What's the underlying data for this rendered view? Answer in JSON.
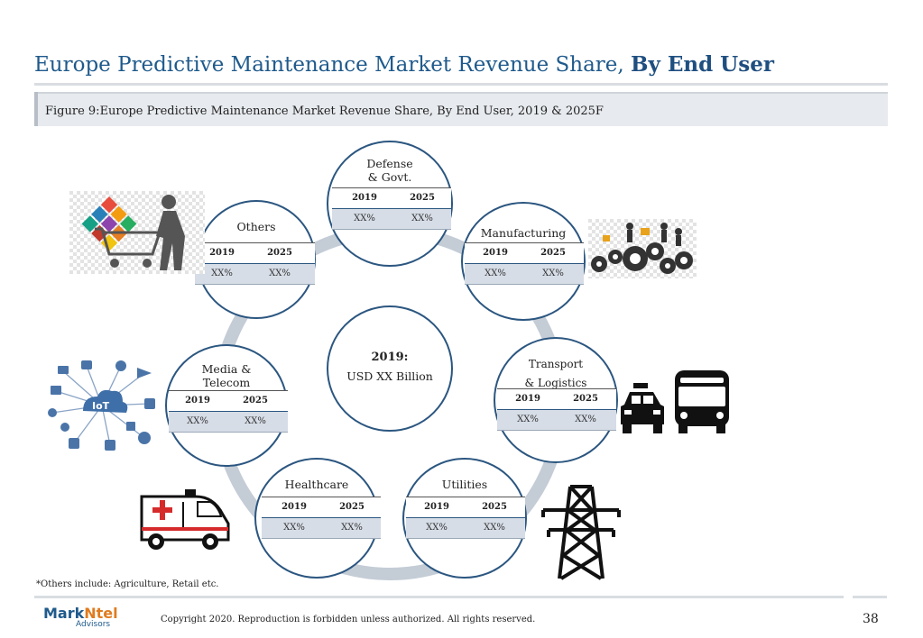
{
  "header": {
    "title_prefix": "Europe Predictive Maintenance Market Revenue Share, ",
    "title_bold": "By End User",
    "figure_label": "Figure 9:Europe Predictive Maintenance Market Revenue Share, By End User, 2019 & 2025F"
  },
  "center": {
    "year_label": "2019:",
    "value": "USD XX Billion"
  },
  "segments": {
    "defense": {
      "name": "Defense & Govt.",
      "col1": "2019",
      "col2": "2025",
      "val1": "XX%",
      "val2": "XX%"
    },
    "manufacturing": {
      "name": "Manufacturing",
      "col1": "2019",
      "col2": "2025",
      "val1": "XX%",
      "val2": "XX%"
    },
    "transport": {
      "name": "Transport & Logistics",
      "col1": "2019",
      "col2": "2025",
      "val1": "XX%",
      "val2": "XX%"
    },
    "utilities": {
      "name": "Utilities",
      "col1": "2019",
      "col2": "2025",
      "val1": "XX%",
      "val2": "XX%"
    },
    "healthcare": {
      "name": "Healthcare",
      "col1": "2019",
      "col2": "2025",
      "val1": "XX%",
      "val2": "XX%"
    },
    "media": {
      "name": "Media & Telecom",
      "col1": "2019",
      "col2": "2025",
      "val1": "XX%",
      "val2": "XX%"
    },
    "others": {
      "name": "Others",
      "col1": "2019",
      "col2": "2025",
      "val1": "XX%",
      "val2": "XX%"
    }
  },
  "icons": {
    "others": "shopping-cart-icon",
    "manufacturing": "gears-icon",
    "media": "iot-network-icon",
    "transport": "taxi-bus-icon",
    "healthcare": "ambulance-icon",
    "utilities": "power-tower-icon"
  },
  "iot_badge": "IoT",
  "footnote": "*Others include: Agriculture, Retail etc.",
  "footer": {
    "logo_main": "Mark",
    "logo_accent": "Ntel",
    "logo_sub": "Advisors",
    "copyright": "Copyright 2020. Reproduction is forbidden unless authorized. All rights reserved.",
    "page_number": "38"
  },
  "colors": {
    "title": "#1f5a8c",
    "node_border": "#2b5680",
    "ring": "#c4ccd6",
    "table_row": "#d6dde7",
    "logo_accent": "#e07b1f"
  }
}
